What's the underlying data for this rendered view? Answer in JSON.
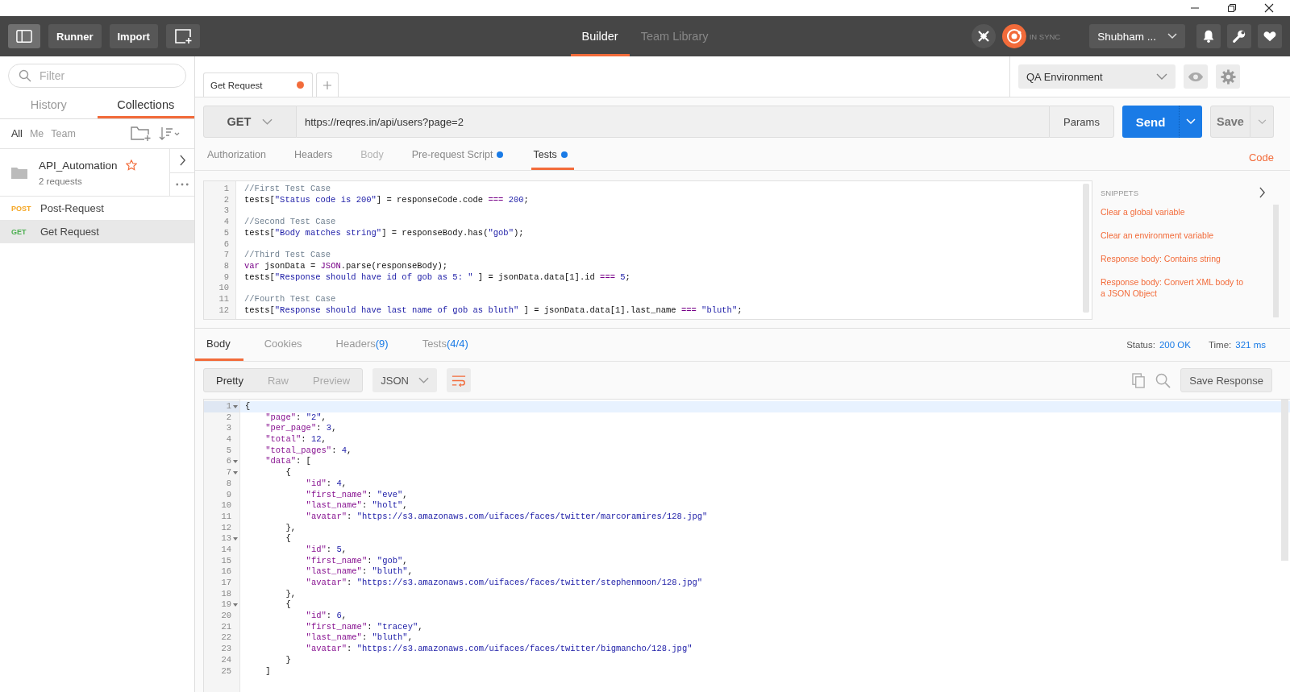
{
  "header": {
    "buttons": [
      "Runner",
      "Import"
    ],
    "tabs": [
      {
        "label": "Builder",
        "selected": true
      },
      {
        "label": "Team Library",
        "selected": false
      }
    ],
    "sync_status": "IN SYNC",
    "user": "Shubham ..."
  },
  "sidebar": {
    "filter": {
      "placeholder": "Filter"
    },
    "tabs": [
      {
        "label": "History",
        "selected": false
      },
      {
        "label": "Collections",
        "selected": true
      }
    ],
    "filters": [
      {
        "label": "All",
        "selected": true
      },
      {
        "label": "Me",
        "selected": false
      },
      {
        "label": "Team",
        "selected": false
      }
    ],
    "collection": {
      "name": "API_Automation",
      "starred": true,
      "count": "2 requests",
      "requests": [
        {
          "method": "POST",
          "color": "#f5a623",
          "name": "Post-Request",
          "selected": false
        },
        {
          "method": "GET",
          "color": "#4caf50",
          "name": "Get Request",
          "selected": true
        }
      ]
    }
  },
  "request_tabs": [
    {
      "label": "Get Request",
      "selected": true,
      "unsaved": true
    }
  ],
  "environment": "QA Environment",
  "request": {
    "method": "GET",
    "url": "https://reqres.in/api/users?page=2",
    "params": "Params",
    "send": "Send",
    "save": "Save"
  },
  "request_sections": [
    {
      "label": "Authorization",
      "selected": false,
      "disabled": false,
      "modified": false
    },
    {
      "label": "Headers",
      "selected": false,
      "disabled": false,
      "modified": false
    },
    {
      "label": "Body",
      "selected": false,
      "disabled": true,
      "modified": false
    },
    {
      "label": "Pre-request Script",
      "selected": false,
      "disabled": false,
      "modified": true
    },
    {
      "label": "Tests",
      "selected": true,
      "disabled": false,
      "modified": true
    }
  ],
  "code_link": "Code",
  "tests_editor": {
    "lines": [
      {
        "n": "1",
        "segs": [
          {
            "kind": "c",
            "text": "//First Test Case"
          }
        ]
      },
      {
        "n": "2",
        "segs": [
          {
            "kind": "p",
            "text": "tests["
          },
          {
            "kind": "s",
            "text": "\"Status code is 200\""
          },
          {
            "kind": "p",
            "text": "] = responseCode.code "
          },
          {
            "kind": "k",
            "text": "==="
          },
          {
            "kind": "n",
            "text": " 200"
          },
          {
            "kind": "p",
            "text": ";"
          }
        ]
      },
      {
        "n": "3"
      },
      {
        "n": "4",
        "segs": [
          {
            "kind": "c",
            "text": "//Second Test Case"
          }
        ]
      },
      {
        "n": "5",
        "segs": [
          {
            "kind": "p",
            "text": "tests["
          },
          {
            "kind": "s",
            "text": "\"Body matches string\""
          },
          {
            "kind": "p",
            "text": "] = responseBody.has("
          },
          {
            "kind": "s",
            "text": "\"gob\""
          },
          {
            "kind": "p",
            "text": ");"
          }
        ]
      },
      {
        "n": "6"
      },
      {
        "n": "7",
        "segs": [
          {
            "kind": "c",
            "text": "//Third Test Case"
          }
        ]
      },
      {
        "n": "8",
        "segs": [
          {
            "kind": "k",
            "text": "var"
          },
          {
            "kind": "p",
            "text": " jsonData = "
          },
          {
            "kind": "k",
            "text": "JSON"
          },
          {
            "kind": "p",
            "text": ".parse(responseBody);"
          }
        ]
      },
      {
        "n": "9",
        "segs": [
          {
            "kind": "p",
            "text": "tests["
          },
          {
            "kind": "s",
            "text": "\"Response should have id of gob as 5: \""
          },
          {
            "kind": "p",
            "text": " ] = jsonData.data[1].id "
          },
          {
            "kind": "k",
            "text": "==="
          },
          {
            "kind": "n",
            "text": " 5"
          },
          {
            "kind": "p",
            "text": ";"
          }
        ]
      },
      {
        "n": "10"
      },
      {
        "n": "11",
        "segs": [
          {
            "kind": "c",
            "text": "//Fourth Test Case"
          }
        ]
      },
      {
        "n": "12",
        "segs": [
          {
            "kind": "p",
            "text": "tests["
          },
          {
            "kind": "s",
            "text": "\"Response should have last name of gob as bluth\""
          },
          {
            "kind": "p",
            "text": " ] = jsonData.data[1].last_name "
          },
          {
            "kind": "k",
            "text": "==="
          },
          {
            "kind": "s",
            "text": " \"bluth\""
          },
          {
            "kind": "p",
            "text": ";"
          }
        ]
      }
    ]
  },
  "snippets": {
    "title": "SNIPPETS",
    "items": [
      "Clear a global variable",
      "Clear an environment variable",
      "Response body: Contains string",
      "Response body: Convert XML body to a JSON Object"
    ]
  },
  "response_tabs": [
    {
      "label": "Body",
      "selected": true
    },
    {
      "label": "Cookies",
      "selected": false
    },
    {
      "label": "Headers",
      "count": "(9)",
      "selected": false
    },
    {
      "label": "Tests",
      "count": "(4/4)",
      "selected": false
    }
  ],
  "status": {
    "label": "Status:",
    "value": "200 OK"
  },
  "time": {
    "label": "Time:",
    "value": "321 ms"
  },
  "view_modes": [
    {
      "label": "Pretty",
      "selected": true
    },
    {
      "label": "Raw",
      "selected": false
    },
    {
      "label": "Preview",
      "selected": false
    }
  ],
  "format": "JSON",
  "save_response": "Save Response",
  "response_body": {
    "lines": [
      {
        "n": "1",
        "fold": true,
        "active": true,
        "segs": [
          {
            "kind": "p",
            "text": "{"
          }
        ]
      },
      {
        "n": "2",
        "fold": false,
        "active": false,
        "segs": [
          {
            "kind": "key",
            "text": "    \"page\""
          },
          {
            "kind": "p",
            "text": ": "
          },
          {
            "kind": "s",
            "text": "\"2\""
          },
          {
            "kind": "p",
            "text": ","
          }
        ]
      },
      {
        "n": "3",
        "fold": false,
        "active": false,
        "segs": [
          {
            "kind": "key",
            "text": "    \"per_page\""
          },
          {
            "kind": "p",
            "text": ": "
          },
          {
            "kind": "n",
            "text": "3"
          },
          {
            "kind": "p",
            "text": ","
          }
        ]
      },
      {
        "n": "4",
        "fold": false,
        "active": false,
        "segs": [
          {
            "kind": "key",
            "text": "    \"total\""
          },
          {
            "kind": "p",
            "text": ": "
          },
          {
            "kind": "n",
            "text": "12"
          },
          {
            "kind": "p",
            "text": ","
          }
        ]
      },
      {
        "n": "5",
        "fold": false,
        "active": false,
        "segs": [
          {
            "kind": "key",
            "text": "    \"total_pages\""
          },
          {
            "kind": "p",
            "text": ": "
          },
          {
            "kind": "n",
            "text": "4"
          },
          {
            "kind": "p",
            "text": ","
          }
        ]
      },
      {
        "n": "6",
        "fold": true,
        "active": false,
        "segs": [
          {
            "kind": "key",
            "text": "    \"data\""
          },
          {
            "kind": "p",
            "text": ": ["
          }
        ]
      },
      {
        "n": "7",
        "fold": true,
        "active": false,
        "segs": [
          {
            "kind": "p",
            "text": "        {"
          }
        ]
      },
      {
        "n": "8",
        "fold": false,
        "active": false,
        "segs": [
          {
            "kind": "key",
            "text": "            \"id\""
          },
          {
            "kind": "p",
            "text": ": "
          },
          {
            "kind": "n",
            "text": "4"
          },
          {
            "kind": "p",
            "text": ","
          }
        ]
      },
      {
        "n": "9",
        "fold": false,
        "active": false,
        "segs": [
          {
            "kind": "key",
            "text": "            \"first_name\""
          },
          {
            "kind": "p",
            "text": ": "
          },
          {
            "kind": "s",
            "text": "\"eve\""
          },
          {
            "kind": "p",
            "text": ","
          }
        ]
      },
      {
        "n": "10",
        "fold": false,
        "active": false,
        "segs": [
          {
            "kind": "key",
            "text": "            \"last_name\""
          },
          {
            "kind": "p",
            "text": ": "
          },
          {
            "kind": "s",
            "text": "\"holt\""
          },
          {
            "kind": "p",
            "text": ","
          }
        ]
      },
      {
        "n": "11",
        "fold": false,
        "active": false,
        "segs": [
          {
            "kind": "key",
            "text": "            \"avatar\""
          },
          {
            "kind": "p",
            "text": ": "
          },
          {
            "kind": "s",
            "text": "\"https://s3.amazonaws.com/uifaces/faces/twitter/marcoramires/128.jpg\""
          }
        ]
      },
      {
        "n": "12",
        "fold": false,
        "active": false,
        "segs": [
          {
            "kind": "p",
            "text": "        },"
          }
        ]
      },
      {
        "n": "13",
        "fold": true,
        "active": false,
        "segs": [
          {
            "kind": "p",
            "text": "        {"
          }
        ]
      },
      {
        "n": "14",
        "fold": false,
        "active": false,
        "segs": [
          {
            "kind": "key",
            "text": "            \"id\""
          },
          {
            "kind": "p",
            "text": ": "
          },
          {
            "kind": "n",
            "text": "5"
          },
          {
            "kind": "p",
            "text": ","
          }
        ]
      },
      {
        "n": "15",
        "fold": false,
        "active": false,
        "segs": [
          {
            "kind": "key",
            "text": "            \"first_name\""
          },
          {
            "kind": "p",
            "text": ": "
          },
          {
            "kind": "s",
            "text": "\"gob\""
          },
          {
            "kind": "p",
            "text": ","
          }
        ]
      },
      {
        "n": "16",
        "fold": false,
        "active": false,
        "segs": [
          {
            "kind": "key",
            "text": "            \"last_name\""
          },
          {
            "kind": "p",
            "text": ": "
          },
          {
            "kind": "s",
            "text": "\"bluth\""
          },
          {
            "kind": "p",
            "text": ","
          }
        ]
      },
      {
        "n": "17",
        "fold": false,
        "active": false,
        "segs": [
          {
            "kind": "key",
            "text": "            \"avatar\""
          },
          {
            "kind": "p",
            "text": ": "
          },
          {
            "kind": "s",
            "text": "\"https://s3.amazonaws.com/uifaces/faces/twitter/stephenmoon/128.jpg\""
          }
        ]
      },
      {
        "n": "18",
        "fold": false,
        "active": false,
        "segs": [
          {
            "kind": "p",
            "text": "        },"
          }
        ]
      },
      {
        "n": "19",
        "fold": true,
        "active": false,
        "segs": [
          {
            "kind": "p",
            "text": "        {"
          }
        ]
      },
      {
        "n": "20",
        "fold": false,
        "active": false,
        "segs": [
          {
            "kind": "key",
            "text": "            \"id\""
          },
          {
            "kind": "p",
            "text": ": "
          },
          {
            "kind": "n",
            "text": "6"
          },
          {
            "kind": "p",
            "text": ","
          }
        ]
      },
      {
        "n": "21",
        "fold": false,
        "active": false,
        "segs": [
          {
            "kind": "key",
            "text": "            \"first_name\""
          },
          {
            "kind": "p",
            "text": ": "
          },
          {
            "kind": "s",
            "text": "\"tracey\""
          },
          {
            "kind": "p",
            "text": ","
          }
        ]
      },
      {
        "n": "22",
        "fold": false,
        "active": false,
        "segs": [
          {
            "kind": "key",
            "text": "            \"last_name\""
          },
          {
            "kind": "p",
            "text": ": "
          },
          {
            "kind": "s",
            "text": "\"bluth\""
          },
          {
            "kind": "p",
            "text": ","
          }
        ]
      },
      {
        "n": "23",
        "fold": false,
        "active": false,
        "segs": [
          {
            "kind": "key",
            "text": "            \"avatar\""
          },
          {
            "kind": "p",
            "text": ": "
          },
          {
            "kind": "s",
            "text": "\"https://s3.amazonaws.com/uifaces/faces/twitter/bigmancho/128.jpg\""
          }
        ]
      },
      {
        "n": "24",
        "fold": false,
        "active": false,
        "segs": [
          {
            "kind": "p",
            "text": "        }"
          }
        ]
      },
      {
        "n": "25",
        "fold": false,
        "active": false,
        "segs": [
          {
            "kind": "p",
            "text": "    ]"
          }
        ]
      }
    ]
  }
}
